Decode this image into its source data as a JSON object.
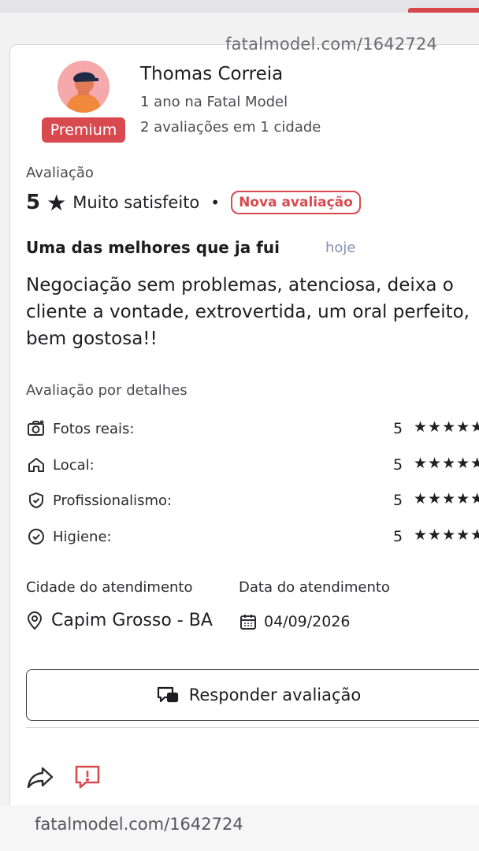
{
  "watermark": "fatalmodel.com/1642724",
  "reviewer": {
    "name": "Thomas Correia",
    "badge": "Premium",
    "tenure": "1 ano na Fatal Model",
    "stats": "2 avaliações em 1 cidade"
  },
  "rating": {
    "label": "Avaliação",
    "score": "5",
    "star": "★",
    "satisfaction": "Muito satisfeito",
    "separator": "•",
    "new_badge": "Nova avaliação"
  },
  "review": {
    "title": "Uma das melhores que ja fui",
    "when": "hoje",
    "text": "Negociação sem problemas, atenciosa, deixa o cliente a vontade, extrovertida, um oral perfeito, bem gostosa!!"
  },
  "details": {
    "heading": "Avaliação por detalhes",
    "items": [
      {
        "label": "Fotos reais:",
        "value": "5",
        "stars": "★★★★★",
        "icon": "camera-icon"
      },
      {
        "label": "Local:",
        "value": "5",
        "stars": "★★★★★",
        "icon": "home-icon"
      },
      {
        "label": "Profissionalismo:",
        "value": "5",
        "stars": "★★★★★",
        "icon": "shield-check-icon"
      },
      {
        "label": "Higiene:",
        "value": "5",
        "stars": "★★★★★",
        "icon": "check-circle-icon"
      }
    ]
  },
  "service": {
    "city_label": "Cidade do atendimento",
    "city": "Capim Grosso - BA",
    "date_label": "Data do atendimento",
    "date": "04/09/2026"
  },
  "actions": {
    "reply": "Responder avaliação"
  },
  "colors": {
    "accent": "#d94a50",
    "text": "#1d1d22",
    "muted": "#4a4a52",
    "time": "#8a8fb8"
  }
}
